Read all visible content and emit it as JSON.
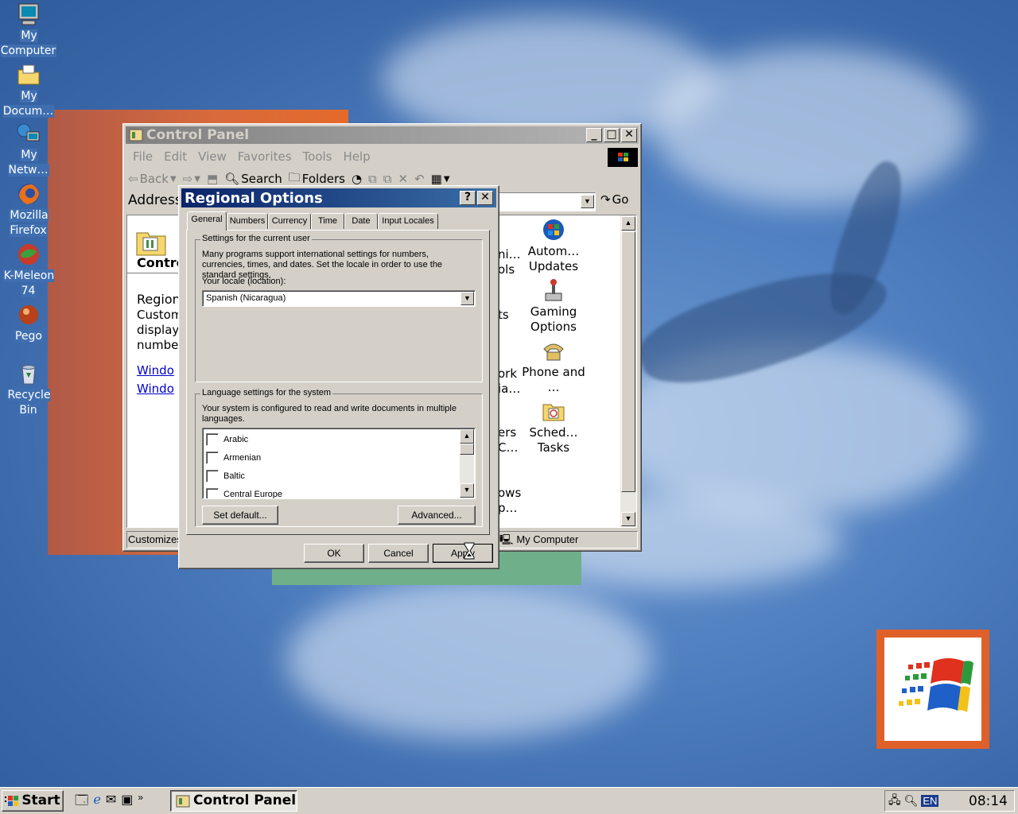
{
  "desktop": {
    "icons": [
      {
        "label": "My Computer",
        "icon": "computer-icon"
      },
      {
        "label": "My Docum…",
        "icon": "folder-icon"
      },
      {
        "label": "My Netw…",
        "icon": "network-icon"
      },
      {
        "label": "Mozilla Firefox",
        "icon": "firefox-icon"
      },
      {
        "label": "K-Meleon 74",
        "icon": "kmeleon-icon"
      },
      {
        "label": "Pego",
        "icon": "pego-icon"
      },
      {
        "label": "Recycle Bin",
        "icon": "recycle-bin-icon"
      }
    ]
  },
  "control_panel": {
    "title": "Control Panel",
    "menu": [
      "File",
      "Edit",
      "View",
      "Favorites",
      "Tools",
      "Help"
    ],
    "toolbar": {
      "back": "Back",
      "search": "Search",
      "folders": "Folders"
    },
    "address_label": "Address",
    "go_label": "Go",
    "left_pane": {
      "heading": "Contro",
      "section_title": "Region",
      "desc_lines": [
        "Custom",
        "display",
        "number"
      ],
      "links": [
        "Windo",
        "Windo"
      ]
    },
    "items": [
      {
        "label": "Autom… Updates",
        "icon": "windows-update-icon"
      },
      {
        "label": "Gaming Options",
        "icon": "joystick-icon"
      },
      {
        "label": "Phone and …",
        "icon": "phone-icon"
      },
      {
        "label": "Sched… Tasks",
        "icon": "scheduled-tasks-icon"
      }
    ],
    "partial_labels": [
      "ni…",
      "ols",
      "ts",
      "ork",
      "ia…",
      "ers",
      "C…",
      "ows",
      "p…"
    ],
    "status_left": "Customizes",
    "status_right": "My Computer"
  },
  "regional_options": {
    "title": "Regional Options",
    "help_btn": "?",
    "close_btn": "✕",
    "tabs": [
      "General",
      "Numbers",
      "Currency",
      "Time",
      "Date",
      "Input Locales"
    ],
    "current_user_group": {
      "legend": "Settings for the current user",
      "desc": "Many programs support international settings for numbers, currencies, times, and dates. Set the locale in order to use the standard settings.",
      "locale_label": "Your locale (location):",
      "locale_value": "Spanish (Nicaragua)"
    },
    "system_group": {
      "legend": "Language settings for the system",
      "desc": "Your system is configured to read and write documents in multiple languages.",
      "languages": [
        "Arabic",
        "Armenian",
        "Baltic",
        "Central Europe"
      ],
      "set_default": "Set default...",
      "advanced": "Advanced..."
    },
    "buttons": {
      "ok": "OK",
      "cancel": "Cancel",
      "apply": "Apply"
    }
  },
  "taskbar": {
    "start": "Start",
    "task": "Control Panel",
    "lang": "EN",
    "clock": "08:14"
  }
}
